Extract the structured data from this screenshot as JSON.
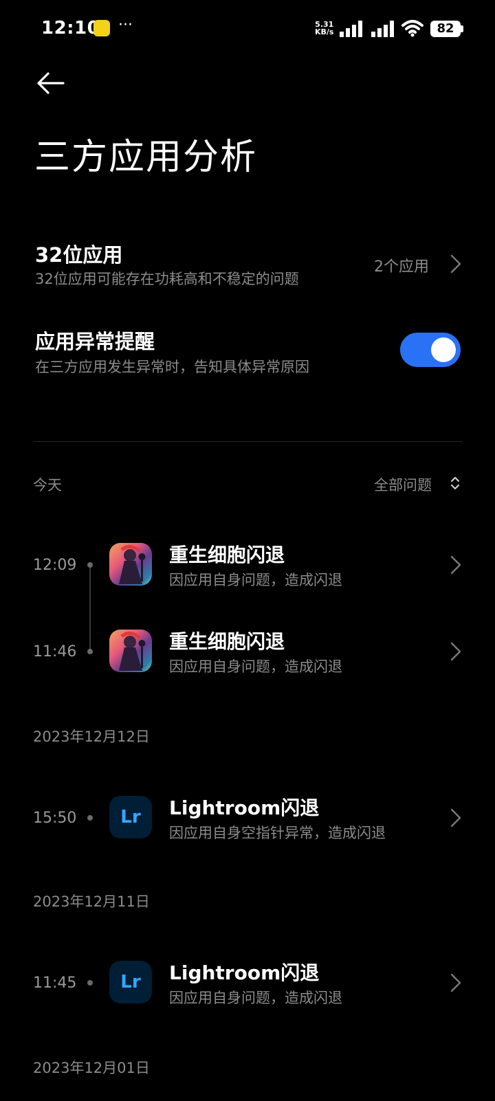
{
  "status_bar": {
    "time": "12:10",
    "app_icon_text": "快",
    "more": "···",
    "speed_value": "5.31",
    "speed_unit": "KB/s",
    "battery": "82"
  },
  "header": {
    "title": "三方应用分析"
  },
  "settings": {
    "bit32": {
      "title": "32位应用",
      "subtitle": "32位应用可能存在功耗高和不稳定的问题",
      "link": "2个应用"
    },
    "crash_alert": {
      "title": "应用异常提醒",
      "subtitle": "在三方应用发生异常时，告知具体异常原因",
      "enabled": true
    }
  },
  "filter": {
    "today_label": "今天",
    "dropdown_label": "全部问题"
  },
  "groups": [
    {
      "date": "今天",
      "entries": [
        {
          "time": "12:09",
          "app_icon": "dead-cells-icon",
          "title": "重生细胞闪退",
          "subtitle": "因应用自身问题，造成闪退"
        },
        {
          "time": "11:46",
          "app_icon": "dead-cells-icon",
          "title": "重生细胞闪退",
          "subtitle": "因应用自身问题，造成闪退"
        }
      ]
    },
    {
      "date": "2023年12月12日",
      "entries": [
        {
          "time": "15:50",
          "app_icon": "lightroom-icon",
          "icon_text": "Lr",
          "title": "Lightroom闪退",
          "subtitle": "因应用自身空指针异常，造成闪退"
        }
      ]
    },
    {
      "date": "2023年12月11日",
      "entries": [
        {
          "time": "11:45",
          "app_icon": "lightroom-icon",
          "icon_text": "Lr",
          "title": "Lightroom闪退",
          "subtitle": "因应用自身问题，造成闪退"
        }
      ]
    },
    {
      "date": "2023年12月01日",
      "entries": []
    }
  ],
  "colors": {
    "background": "#000000",
    "accent": "#2a72f5",
    "secondary_text": "#8c8c8c",
    "lightroom_bg": "#001e36",
    "lightroom_fg": "#31a8ff"
  }
}
